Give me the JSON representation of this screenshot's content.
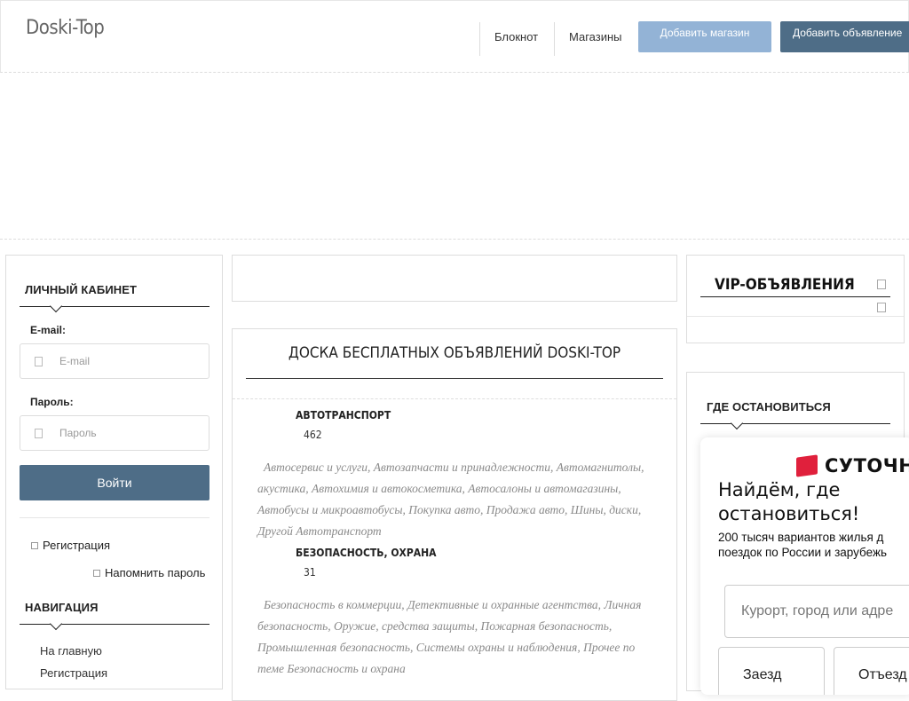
{
  "header": {
    "logo": "Doski-Top",
    "nav": [
      "Блокнот",
      "Магазины"
    ],
    "add_shop": "Добавить магазин",
    "add_ad": "Добавить объявление"
  },
  "sidebar_left": {
    "cabinet_title": "ЛИЧНЫЙ КАБИНЕТ",
    "email_label": "E-mail:",
    "email_placeholder": "E-mail",
    "password_label": "Пароль:",
    "password_placeholder": "Пароль",
    "login_button": "Войти",
    "register_link": "Регистрация",
    "remind_link": "Напомнить пароль",
    "nav_title": "НАВИГАЦИЯ",
    "nav_items": [
      "На главную",
      "Регистрация"
    ]
  },
  "main": {
    "title": "ДОСКА БЕСПЛАТНЫХ ОБЪЯВЛЕНИЙ DOSKI-TOP",
    "categories": [
      {
        "name": "АВТОТРАНСПОРТ",
        "count": "462",
        "subs": "Автосервис и услуги, Автозапчасти и принадлежности, Автомагнитолы, акустика, Автохимия и автокосметика, Автосалоны и автомагазины, Автобусы и микроавтобусы, Покупка авто, Продажа авто, Шины, диски, Другой Автотранспорт"
      },
      {
        "name": "БЕЗОПАСНОСТЬ, ОХРАНА",
        "count": "31",
        "subs": "Безопасность в коммерции, Детективные и охранные агентства, Личная безопасность, Оружие, средства защиты, Пожарная безопасность, Промышленная безопасность, Системы охраны и наблюдения, Прочее по теме Безопасность и охрана"
      }
    ]
  },
  "sidebar_right": {
    "vip_title": "VIP-ОБЪЯВЛЕНИЯ",
    "where_title": "ГДЕ ОСТАНОВИТЬСЯ",
    "widget": {
      "brand": "СУТОЧНО",
      "heading": "Найдём, где\nостановиться!",
      "text": "200 тысяч вариантов жилья д\nпоездок по России и зарубежь",
      "search_placeholder": "Курорт, город или адре",
      "checkin": "Заезд",
      "checkout": "Отъезд"
    }
  },
  "colors": {
    "primary_button": "#4e6d87",
    "light_button": "#93b3d6",
    "brand_red": "#e0203c"
  }
}
